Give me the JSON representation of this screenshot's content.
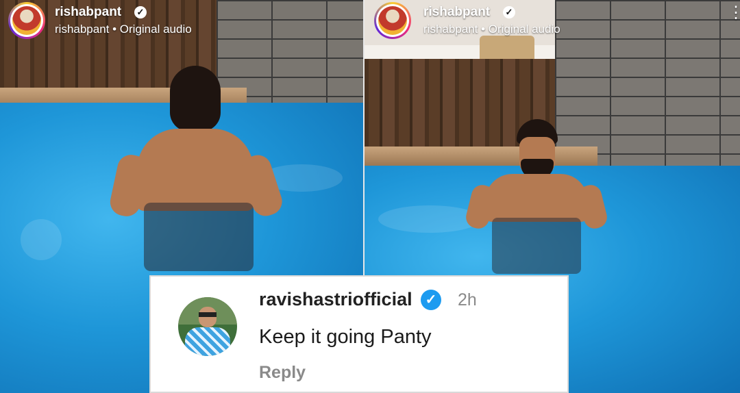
{
  "posts": [
    {
      "username": "rishabpant",
      "subtitle": "rishabpant • Original audio",
      "verified_icon": "verified-badge-icon"
    },
    {
      "username": "rishabpant",
      "subtitle": "rishabpant • Original audio",
      "verified_icon": "verified-badge-icon",
      "menu_icon": "more-vertical-icon"
    }
  ],
  "comment": {
    "username": "ravishastriofficial",
    "time": "2h",
    "text": "Keep it going Panty",
    "reply_label": "Reply",
    "verified_color": "#1d9bf0"
  },
  "colors": {
    "pool_blue": "#1e96d8",
    "story_ring": "#ee2a7b"
  }
}
